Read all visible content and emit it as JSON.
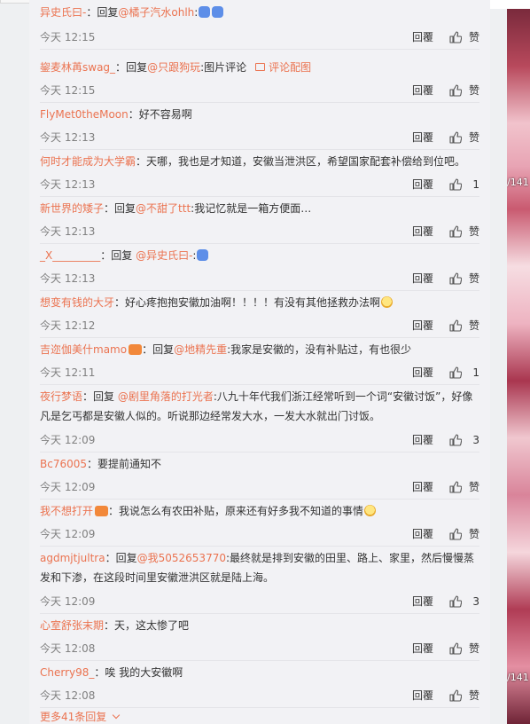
{
  "comments": [
    {
      "user": "异史氏曰-",
      "sep": "：",
      "prefix": "回复",
      "at": "@橘子汽水ohlh",
      "after": ":",
      "pic_ref": "",
      "body": "",
      "emojis": 2,
      "badge": false,
      "time": "今天 12:15",
      "reply": "回覆",
      "likes": "赞"
    },
    {
      "user": "鋆麦林苒swag_",
      "sep": "：",
      "prefix": "回复",
      "at": "@只跟狗玩",
      "after": ":图片评论",
      "pic_ref": "评论配图",
      "body": "",
      "emojis": 0,
      "badge": false,
      "time": "今天 12:15",
      "reply": "回覆",
      "likes": "赞"
    },
    {
      "user": "FlyMet0theMoon",
      "sep": "：",
      "prefix": "",
      "at": "",
      "after": "",
      "pic_ref": "",
      "body": "好不容易啊",
      "emojis": 0,
      "badge": false,
      "time": "今天 12:13",
      "reply": "回覆",
      "likes": "赞"
    },
    {
      "user": "何时才能成为大学霸",
      "sep": "：",
      "prefix": "",
      "at": "",
      "after": "",
      "pic_ref": "",
      "body": "天哪，我也是才知道，安徽当泄洪区，希望国家配套补偿给到位吧。",
      "emojis": 0,
      "badge": false,
      "time": "今天 12:13",
      "reply": "回覆",
      "likes": "1"
    },
    {
      "user": "新世界的矮子",
      "sep": "：",
      "prefix": "回复",
      "at": "@不甜了ttt",
      "after": ":我记忆就是一箱方便面…",
      "pic_ref": "",
      "body": "",
      "emojis": 0,
      "badge": false,
      "time": "今天 12:13",
      "reply": "回覆",
      "likes": "赞"
    },
    {
      "user": "_X_________",
      "sep": "：",
      "prefix": "回复 ",
      "at": "@异史氏曰-",
      "after": ":",
      "pic_ref": "",
      "body": "",
      "emojis": 1,
      "badge": false,
      "time": "今天 12:13",
      "reply": "回覆",
      "likes": "赞"
    },
    {
      "user": "想变有钱的大牙",
      "sep": "：",
      "prefix": "",
      "at": "",
      "after": "",
      "pic_ref": "",
      "body": "好心疼抱抱安徽加油啊！！！！有没有其他拯救办法啊",
      "emojis": 1,
      "badge": false,
      "time": "今天 12:12",
      "reply": "回覆",
      "likes": "赞"
    },
    {
      "user": "吉迩伽美什mamo",
      "sep": "：",
      "prefix": "回复",
      "at": "@地精先重",
      "after": ":我家是安徽的，没有补贴过，有也很少",
      "pic_ref": "",
      "body": "",
      "emojis": 0,
      "badge": true,
      "time": "今天 12:11",
      "reply": "回覆",
      "likes": "1"
    },
    {
      "user": "夜行梦语",
      "sep": "：",
      "prefix": "回复 ",
      "at": "@剧里角落的打光者",
      "after": ":八九十年代我们浙江经常听到一个词“安徽讨饭”，好像凡是乞丐都是安徽人似的。听说那边经常发大水，一发大水就出门讨饭。",
      "pic_ref": "",
      "body": "",
      "emojis": 0,
      "badge": false,
      "time": "今天 12:09",
      "reply": "回覆",
      "likes": "3"
    },
    {
      "user": "Bc76005",
      "sep": "：",
      "prefix": "",
      "at": "",
      "after": "",
      "pic_ref": "",
      "body": "要提前通知不",
      "emojis": 0,
      "badge": false,
      "time": "今天 12:09",
      "reply": "回覆",
      "likes": "赞"
    },
    {
      "user": "我不想打开",
      "sep": "：",
      "prefix": "",
      "at": "",
      "after": "",
      "pic_ref": "",
      "body": "我说怎么有农田补贴，原来还有好多我不知道的事情",
      "emojis": 1,
      "badge": true,
      "time": "今天 12:09",
      "reply": "回覆",
      "likes": "赞"
    },
    {
      "user": "agdmjtjultra",
      "sep": "：",
      "prefix": "回复",
      "at": "@我5052653770",
      "after": ":最终就是排到安徽的田里、路上、家里，然后慢慢蒸发和下渗，在这段时间里安徽泄洪区就是陆上海。",
      "pic_ref": "",
      "body": "",
      "emojis": 0,
      "badge": false,
      "time": "今天 12:09",
      "reply": "回覆",
      "likes": "3"
    },
    {
      "user": "心室舒张末期",
      "sep": "：",
      "prefix": "",
      "at": "",
      "after": "",
      "pic_ref": "",
      "body": "天，这太惨了吧",
      "emojis": 0,
      "badge": false,
      "time": "今天 12:08",
      "reply": "回覆",
      "likes": "赞"
    },
    {
      "user": "Cherry98_",
      "sep": "：",
      "prefix": "",
      "at": "",
      "after": "",
      "pic_ref": "",
      "body": "唉 我的大安徽啊",
      "emojis": 0,
      "badge": false,
      "time": "今天 12:08",
      "reply": "回覆",
      "likes": "赞"
    }
  ],
  "more_replies": "更多41条回复",
  "side_labels": [
    "/141",
    "/141"
  ],
  "colors": {
    "link": "#eb7350",
    "text": "#333333",
    "time": "#808080",
    "panel": "#f2f2f5"
  }
}
